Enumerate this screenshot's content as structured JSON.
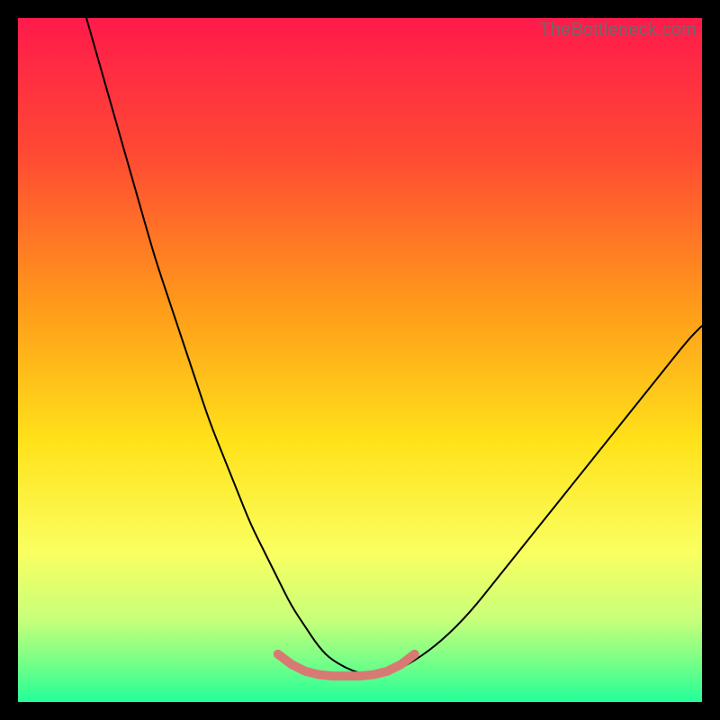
{
  "watermark": "TheBottleneck.com",
  "chart_data": {
    "type": "line",
    "title": "",
    "xlabel": "",
    "ylabel": "",
    "xlim": [
      0,
      100
    ],
    "ylim": [
      0,
      100
    ],
    "grid": false,
    "legend": false,
    "gradient_stops": [
      {
        "offset": 0.0,
        "color": "#ff1a4b"
      },
      {
        "offset": 0.2,
        "color": "#ff4a33"
      },
      {
        "offset": 0.42,
        "color": "#ff9a1a"
      },
      {
        "offset": 0.62,
        "color": "#ffe21a"
      },
      {
        "offset": 0.78,
        "color": "#faff60"
      },
      {
        "offset": 0.88,
        "color": "#c7ff7a"
      },
      {
        "offset": 0.95,
        "color": "#6bff8a"
      },
      {
        "offset": 1.0,
        "color": "#23ff9a"
      }
    ],
    "series": [
      {
        "name": "curve",
        "stroke": "#000000",
        "stroke_width": 2,
        "x": [
          10,
          12,
          14,
          16,
          18,
          20,
          22,
          24,
          26,
          28,
          30,
          32,
          34,
          36,
          38,
          40,
          42,
          44,
          46,
          50,
          54,
          58,
          62,
          66,
          70,
          74,
          78,
          82,
          86,
          90,
          94,
          98,
          100
        ],
        "y": [
          100,
          93,
          86,
          79,
          72,
          65,
          59,
          53,
          47,
          41,
          36,
          31,
          26,
          22,
          18,
          14,
          11,
          8,
          6,
          4,
          4,
          6,
          9,
          13,
          18,
          23,
          28,
          33,
          38,
          43,
          48,
          53,
          55
        ]
      },
      {
        "name": "highlight-segment",
        "stroke": "#d77a74",
        "stroke_width": 10,
        "linecap": "round",
        "x": [
          38,
          40,
          42,
          44,
          46,
          48,
          50,
          52,
          54,
          56,
          58
        ],
        "y": [
          7,
          5.5,
          4.5,
          4,
          3.8,
          3.8,
          3.8,
          4,
          4.5,
          5.5,
          7
        ]
      }
    ]
  }
}
